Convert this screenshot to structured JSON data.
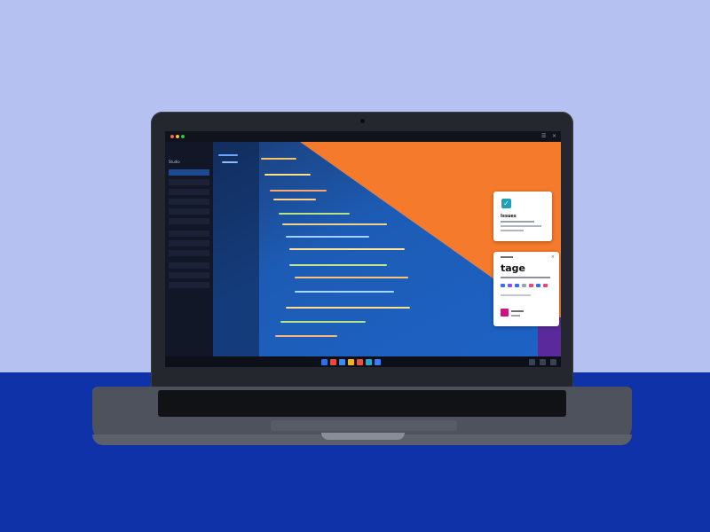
{
  "colors": {
    "wall": "#b4c1f1",
    "desk": "#0f32a8",
    "laptop_body": "#4d525c",
    "screen_orange": "#f57a2b",
    "screen_blue": "#1d62c5",
    "accent_check": "#1ba1ba",
    "accent_pink": "#c7177c"
  },
  "icons": {
    "check": "check-icon",
    "close": "close-icon"
  },
  "screen": {
    "sidebar_title": "Studio",
    "card_top": {
      "title": "Issues"
    },
    "card_bottom": {
      "title": "tage"
    }
  }
}
